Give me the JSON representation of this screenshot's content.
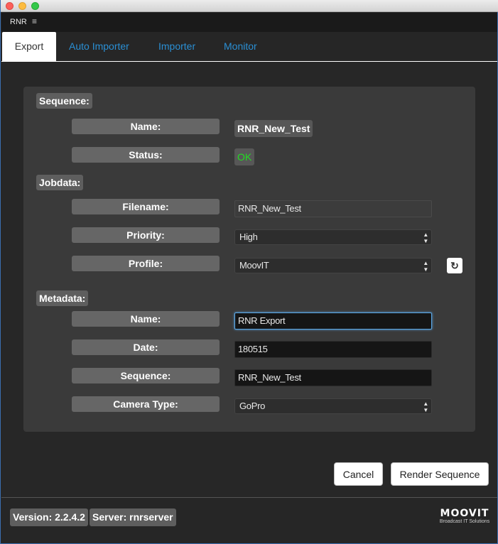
{
  "panel": {
    "title": "RNR",
    "menu_icon": "hamburger-icon"
  },
  "tabs": [
    {
      "label": "Export",
      "active": true
    },
    {
      "label": "Auto Importer",
      "active": false
    },
    {
      "label": "Importer",
      "active": false
    },
    {
      "label": "Monitor",
      "active": false
    }
  ],
  "sequence": {
    "header": "Sequence:",
    "name_label": "Name:",
    "name_value": "RNR_New_Test",
    "status_label": "Status:",
    "status_value": "OK"
  },
  "jobdata": {
    "header": "Jobdata:",
    "filename_label": "Filename:",
    "filename_value": "RNR_New_Test",
    "priority_label": "Priority:",
    "priority_value": "High",
    "profile_label": "Profile:",
    "profile_value": "MoovIT",
    "refresh_icon": "refresh-icon"
  },
  "metadata": {
    "header": "Metadata:",
    "name_label": "Name:",
    "name_value": "RNR Export",
    "date_label": "Date:",
    "date_value": "180515",
    "sequence_label": "Sequence:",
    "sequence_value": "RNR_New_Test",
    "camera_label": "Camera Type:",
    "camera_value": "GoPro"
  },
  "actions": {
    "cancel": "Cancel",
    "render": "Render Sequence"
  },
  "footer": {
    "version": "Version: 2.2.4.2",
    "server": "Server: rnrserver",
    "logo_text": "MOOVIT",
    "logo_sub": "Broadcast IT Solutions"
  },
  "colors": {
    "accent": "#2a8fd4",
    "status_ok": "#22dd22",
    "focus": "#5aa7e6"
  }
}
